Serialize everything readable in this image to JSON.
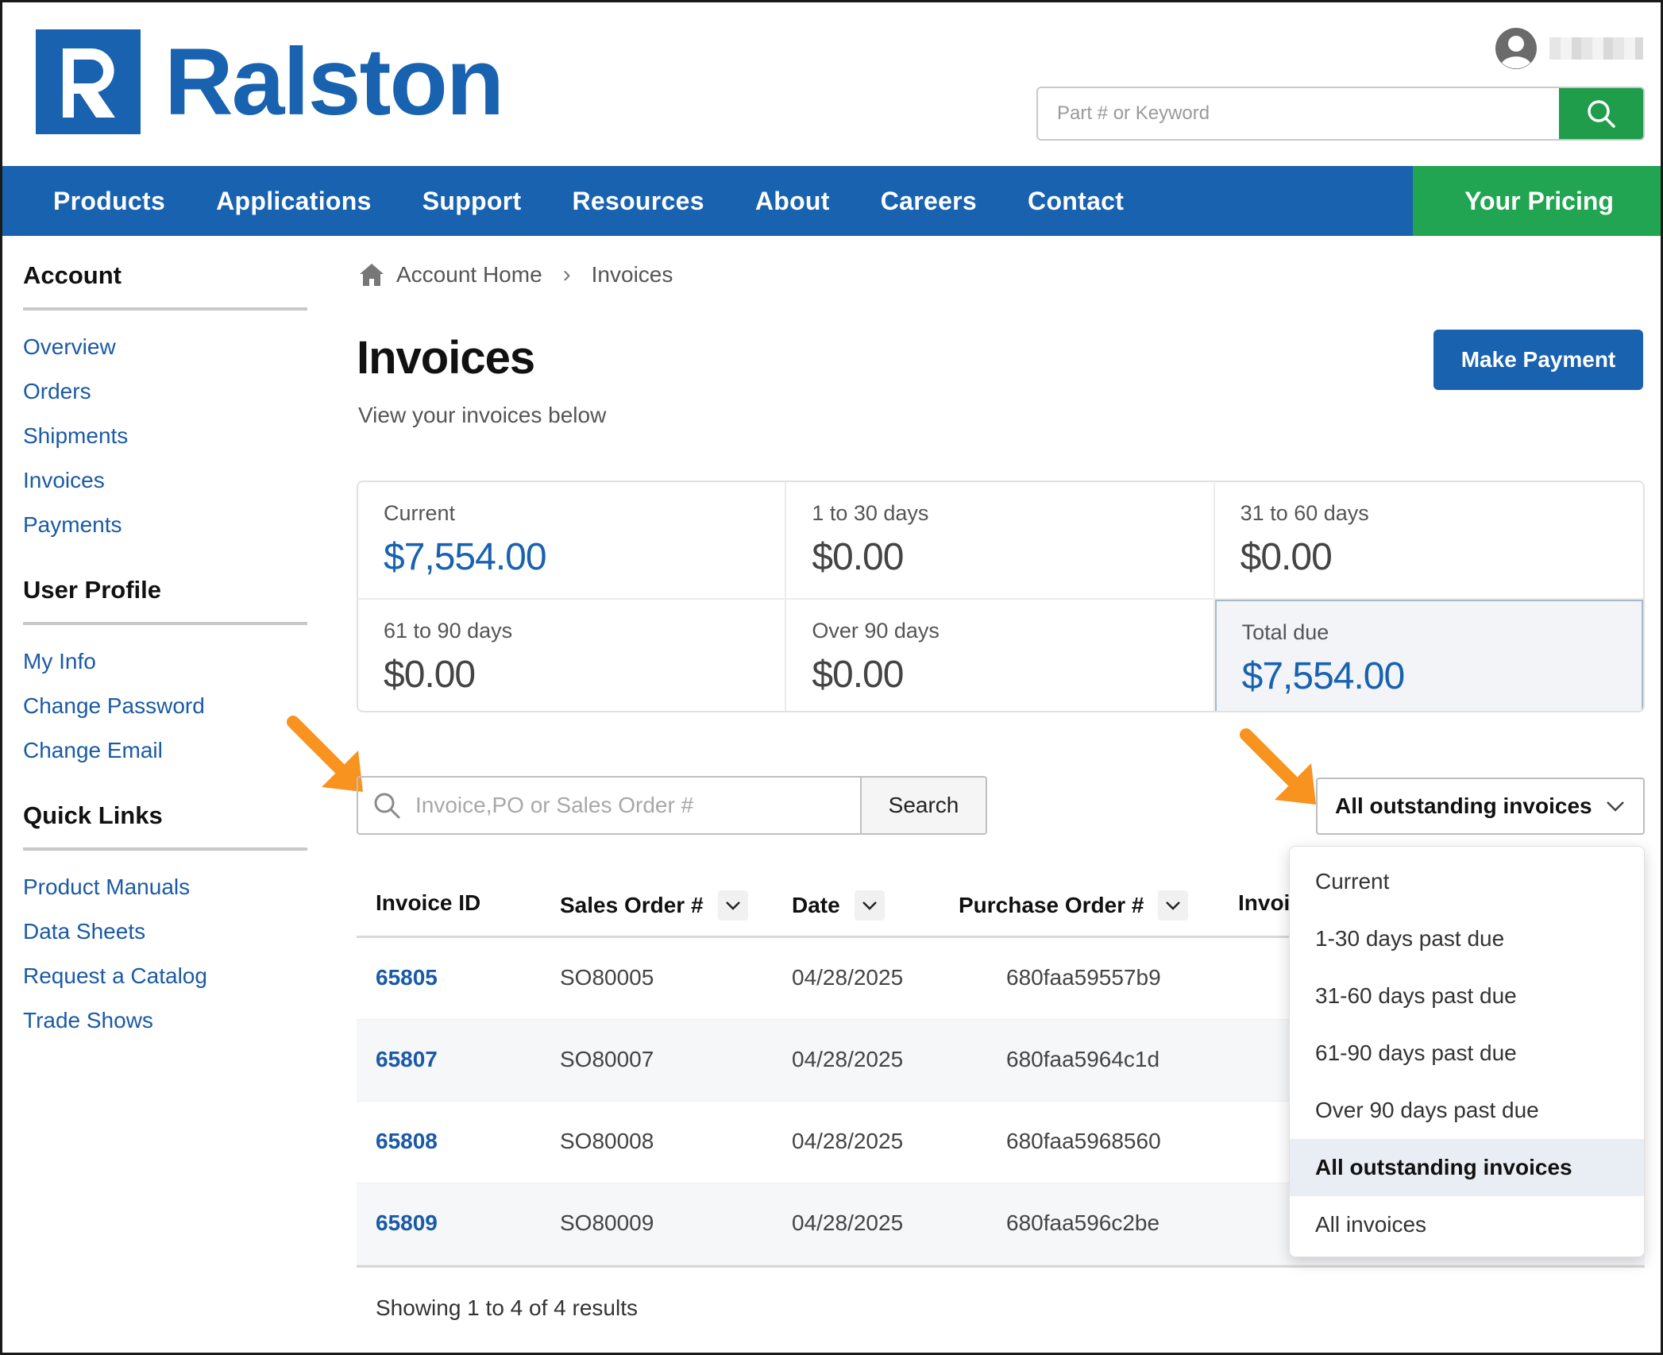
{
  "brand": {
    "name": "Ralston",
    "color": "#1862b0"
  },
  "header": {
    "search_placeholder": "Part # or Keyword",
    "search_icon": "search-icon",
    "user_icon": "user-avatar-icon"
  },
  "nav": {
    "items": [
      "Products",
      "Applications",
      "Support",
      "Resources",
      "About",
      "Careers",
      "Contact"
    ],
    "pricing": "Your Pricing",
    "pricing_color": "#21a552"
  },
  "sidebar": {
    "account": {
      "heading": "Account",
      "links": [
        "Overview",
        "Orders",
        "Shipments",
        "Invoices",
        "Payments"
      ]
    },
    "profile": {
      "heading": "User Profile",
      "links": [
        "My Info",
        "Change Password",
        "Change Email"
      ]
    },
    "quick": {
      "heading": "Quick Links",
      "links": [
        "Product Manuals",
        "Data Sheets",
        "Request a Catalog",
        "Trade Shows"
      ]
    }
  },
  "breadcrumb": {
    "home": "Account Home",
    "current": "Invoices",
    "home_icon": "home-icon"
  },
  "page": {
    "title": "Invoices",
    "subtitle": "View your invoices below",
    "make_payment": "Make Payment"
  },
  "summary": [
    {
      "label": "Current",
      "value": "$7,554.00"
    },
    {
      "label": "1 to 30 days",
      "value": "$0.00"
    },
    {
      "label": "31 to 60 days",
      "value": "$0.00"
    },
    {
      "label": "61 to 90 days",
      "value": "$0.00"
    },
    {
      "label": "Over 90 days",
      "value": "$0.00"
    },
    {
      "label": "Total due",
      "value": "$7,554.00"
    }
  ],
  "invoice_search": {
    "placeholder": "Invoice,PO or Sales Order #",
    "button": "Search"
  },
  "filter": {
    "selected": "All outstanding invoices",
    "options": [
      "Current",
      "1-30 days past due",
      "31-60 days past due",
      "61-90 days past due",
      "Over 90 days past due",
      "All outstanding invoices",
      "All invoices"
    ]
  },
  "table": {
    "headers": {
      "invoice_id": "Invoice ID",
      "sales_order": "Sales Order #",
      "date": "Date",
      "purchase_order": "Purchase Order #",
      "invoice_partial": "Invoi"
    },
    "rows": [
      {
        "invoice_id": "65805",
        "sales_order": "SO80005",
        "date": "04/28/2025",
        "purchase_order": "680faa59557b9"
      },
      {
        "invoice_id": "65807",
        "sales_order": "SO80007",
        "date": "04/28/2025",
        "purchase_order": "680faa5964c1d"
      },
      {
        "invoice_id": "65808",
        "sales_order": "SO80008",
        "date": "04/28/2025",
        "purchase_order": "680faa5968560"
      },
      {
        "invoice_id": "65809",
        "sales_order": "SO80009",
        "date": "04/28/2025",
        "purchase_order": "680faa596c2be"
      }
    ],
    "showing": "Showing 1 to 4 of 4 results"
  },
  "annotation": {
    "arrow_color": "#f7931e"
  }
}
